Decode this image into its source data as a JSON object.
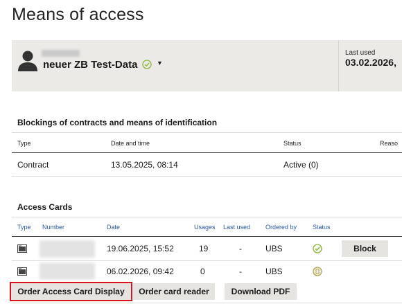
{
  "page": {
    "title": "Means of access"
  },
  "profile": {
    "name": "neuer ZB Test-Data",
    "last_used_label": "Last used",
    "last_used_value": "03.02.2026,"
  },
  "blockings": {
    "title": "Blockings of contracts and means of identification",
    "headers": {
      "type": "Type",
      "datetime": "Date and time",
      "status": "Status",
      "reason": "Reaso"
    },
    "rows": [
      {
        "type": "Contract",
        "datetime": "13.05.2025, 08:14",
        "status": "Active (0)"
      }
    ]
  },
  "access_cards": {
    "title": "Access Cards",
    "headers": {
      "type": "Type",
      "number": "Number",
      "date": "Date",
      "usages": "Usages",
      "last_used": "Last used",
      "ordered_by": "Ordered by",
      "status": "Status"
    },
    "rows": [
      {
        "date": "19.06.2025, 15:52",
        "usages": "19",
        "last_used": "-",
        "ordered_by": "UBS",
        "status_icon": "check-circle-icon",
        "action": "Block"
      },
      {
        "date": "06.02.2026, 09:42",
        "usages": "0",
        "last_used": "-",
        "ordered_by": "UBS",
        "status_icon": "pending-circle-icon",
        "action": ""
      }
    ]
  },
  "actions": {
    "order_display": "Order Access Card Display",
    "order_reader": "Order card reader",
    "download_pdf": "Download PDF"
  },
  "colors": {
    "profile_bg": "#eceae7",
    "header_blue": "#2c58a6",
    "highlight_red": "#d9121f",
    "check_green": "#8ab43a",
    "button_bg": "#e6e4e1"
  }
}
